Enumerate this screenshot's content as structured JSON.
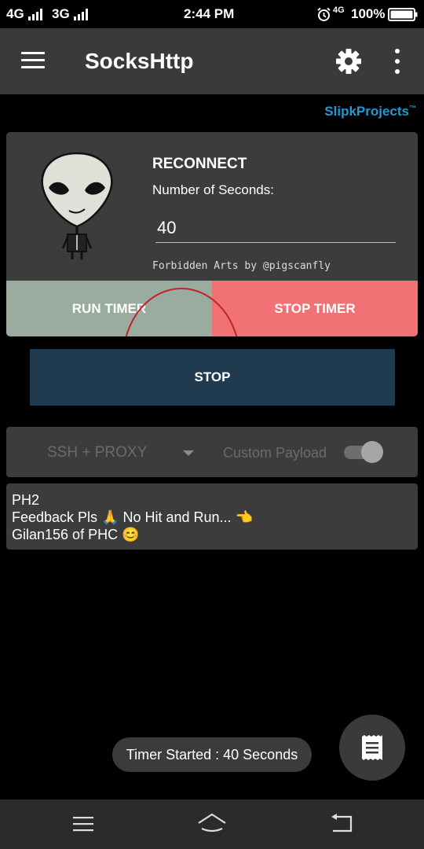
{
  "status_bar": {
    "network1": "4G",
    "network2": "3G",
    "time": "2:44 PM",
    "network3": "4G",
    "battery": "100%"
  },
  "app_bar": {
    "title": "SocksHttp",
    "menu_icon": "hamburger-menu-icon",
    "settings_icon": "gear-icon",
    "overflow_icon": "more-vert-icon"
  },
  "brand": {
    "name": "SlipkProjects",
    "tm": "™"
  },
  "timer_card": {
    "title": "RECONNECT",
    "seconds_label": "Number of Seconds:",
    "seconds_value": "40",
    "credit": "Forbidden Arts by @pigscanfly",
    "run_timer_label": "RUN TIMER",
    "stop_timer_label": "STOP TIMER"
  },
  "stop_button_label": "STOP",
  "mode": {
    "selected": "SSH + PROXY",
    "payload_label": "Custom Payload"
  },
  "notes": {
    "line1": "PH2",
    "line2": "Feedback Pls 🙏 No Hit and Run... 👈",
    "line3": "Gilan156 of PHC 😊"
  },
  "toast": "Timer Started : 40 Seconds",
  "fab_icon": "log-icon",
  "nav_bar": {
    "menu_icon": "recent-apps-icon",
    "home_icon": "home-icon",
    "back_icon": "back-icon"
  },
  "colors": {
    "app_bar": "#3a3a3a",
    "card": "#3c3c3c",
    "run_timer": "#9aab9f",
    "stop_timer": "#f07274",
    "stop_button": "#203a50",
    "brand": "#1e9ad6",
    "annotation_circle": "#c0242b"
  }
}
